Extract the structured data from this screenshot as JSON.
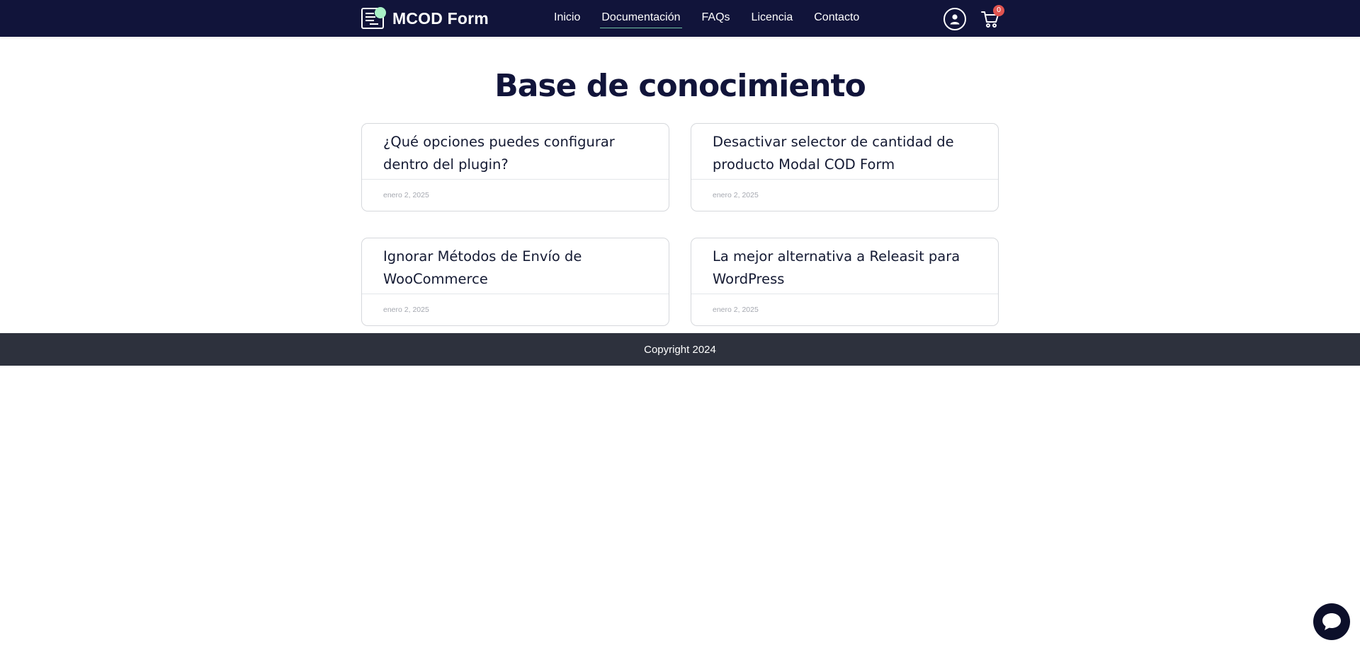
{
  "header": {
    "logo_text": "MCOD Form",
    "logo_icon": "form-document-icon",
    "nav": [
      {
        "label": "Inicio",
        "active": false
      },
      {
        "label": "Documentación",
        "active": true
      },
      {
        "label": "FAQs",
        "active": false
      },
      {
        "label": "Licencia",
        "active": false
      },
      {
        "label": "Contacto",
        "active": false
      }
    ],
    "user_icon": "user-circle-icon",
    "cart_icon": "shopping-cart-icon",
    "cart_count": "0"
  },
  "main": {
    "title": "Base de conocimiento",
    "articles": [
      {
        "title": "¿Qué opciones puedes configurar dentro del plugin?",
        "date": "enero 2, 2025"
      },
      {
        "title": "Desactivar selector de cantidad de producto Modal COD Form",
        "date": "enero 2, 2025"
      },
      {
        "title": "Ignorar Métodos de Envío de WooCommerce",
        "date": "enero 2, 2025"
      },
      {
        "title": "La mejor alternativa a Releasit para WordPress",
        "date": "enero 2, 2025"
      }
    ]
  },
  "footer": {
    "copyright": "Copyright 2024"
  },
  "chat": {
    "icon": "chat-bubble-icon"
  },
  "colors": {
    "header_bg": "#11143a",
    "accent_green": "#6fc3a3",
    "badge_red": "#e0534f",
    "footer_bg": "#2d313d",
    "title_color": "#11143a"
  }
}
